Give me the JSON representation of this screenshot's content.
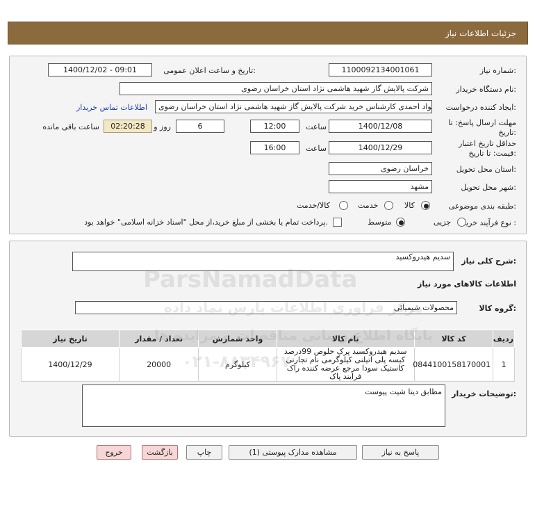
{
  "header": {
    "title": "جزئیات اطلاعات نیاز"
  },
  "form": {
    "need_no_label": "شماره نیاز:",
    "need_no": "1100092134001061",
    "announce_label": "تاریخ و ساعت اعلان عمومی:",
    "announce_value": "1400/12/02 - 09:01",
    "buyer_org_label": "نام دستگاه خریدار:",
    "buyer_org": "شرکت پالایش گاز شهید هاشمی نژاد   استان خراسان رضوی",
    "creator_label": "ایجاد کننده درخواست:",
    "creator": "جواد احمدی کارشناس خرید شرکت پالایش گاز شهید هاشمی نژاد   استان خراسان رضوی",
    "contact_link": "اطلاعات تماس خریدار",
    "deadline_label_1": "مهلت ارسال پاسخ: تا",
    "deadline_label_2": "تاریخ:",
    "deadline_date": "1400/12/08",
    "time_label": "ساعت",
    "deadline_time": "12:00",
    "days_value": "6",
    "days_label": "روز و",
    "remaining_time": "02:20:28",
    "remaining_label": "ساعت باقی مانده",
    "validity_label_1": "حداقل تاریخ اعتبار",
    "validity_label_2": "قیمت: تا تاریخ:",
    "validity_date": "1400/12/29",
    "validity_time": "16:00",
    "province_label": "استان محل تحویل:",
    "province": "خراسان رضوی",
    "city_label": "شهر محل تحویل:",
    "city": "مشهد",
    "category_label": "طبقه بندی موضوعی:",
    "category_options": [
      "کالا",
      "خدمت",
      "کالا/خدمت"
    ],
    "process_label": "نوع فرآیند خرید :",
    "process_options": [
      "جزیی",
      "متوسط"
    ],
    "payment_note": "پرداخت تمام یا بخشی از مبلغ خرید،از محل \"اسناد خزانه اسلامی\" خواهد بود."
  },
  "need": {
    "summary_label": "شرح کلی نیاز:",
    "summary": "سدیم هیدروکسید",
    "goods_info_title": "اطلاعات کالاهای مورد نیاز",
    "group_label": "گروه کالا:",
    "group": "محصولات شیمیائی"
  },
  "table": {
    "headers": [
      "ردیف",
      "کد کالا",
      "نام کالا",
      "واحد شمارش",
      "تعداد / مقدار",
      "تاریخ نیاز"
    ],
    "rows": [
      {
        "row": "1",
        "code": "0844100158170001",
        "name": "سدیم هیدروکسید پرک خلوص 99درصد کیسه پلی اتیلنی کیلوگرمی نام تجارتی کاستیک سودا مرجع عرضه کننده راک فرایند پاک",
        "unit": "کیلوگرم",
        "qty": "20000",
        "date": "1400/12/29"
      }
    ]
  },
  "buyer_notes": {
    "label": "توضیحات خریدار:",
    "text": "مطابق دیتا شیت پیوست"
  },
  "buttons": {
    "reply": "پاسخ به نیاز",
    "docs": "مشاهده مدارک پیوستی (1)",
    "print": "چاپ",
    "back": "بازگشت",
    "exit": "خروج"
  },
  "watermark": {
    "brand": "ParsNamadData",
    "line1": "مرکز فراوری اطلاعات پارس نماد داده",
    "line2": "پایگاه اطلاع رسانی مناقصات و مزایده ها",
    "phone": "۰۲۱-۸۸۳۴۹۶۷۰"
  },
  "colors": {
    "title_bar": "#8b6a3e",
    "link": "#1a3fae",
    "remaining_bg": "#f3e8c4"
  }
}
